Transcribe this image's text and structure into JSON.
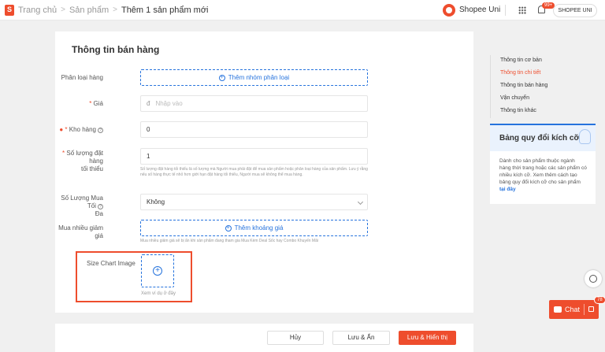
{
  "topbar": {
    "breadcrumb": [
      "Trang chủ",
      "Sản phẩm",
      "Thêm 1 sản phẩm mới"
    ],
    "shop_name": "Shopee Uni",
    "notification_badge": "99+",
    "user_label": "SHOPEE UNI"
  },
  "form": {
    "section_title": "Thông tin bán hàng",
    "variation": {
      "label": "Phân loại hàng",
      "button": "Thêm nhóm phân loại"
    },
    "price": {
      "label": "Giá",
      "currency": "đ",
      "placeholder": "Nhập vào"
    },
    "stock": {
      "label": "Kho hàng",
      "value": "0"
    },
    "min_qty": {
      "label_line1": "Số lượng đặt hàng",
      "label_line2": "tối thiểu",
      "value": "1",
      "help": "Số lượng đặt hàng tối thiểu là số lượng mà Người mua phải đặt để mua sản phẩm hoặc phân loại hàng của sản phẩm. Lưu ý rằng nếu số hàng thực tế nhỏ hơn giới hạn đặt hàng tối thiểu, Người mua sẽ không thể mua hàng."
    },
    "max_qty": {
      "label_line1": "Số Lượng Mua Tối",
      "label_line2": "Đa",
      "value": "Không"
    },
    "wholesale": {
      "label": "Mua nhiều giảm giá",
      "button": "Thêm khoảng giá",
      "help": "Mua nhiều giảm giá sẽ bị ẩn khi sản phẩm đang tham gia Mua Kèm Deal Sốc hay Combo Khuyến Mãi"
    },
    "size_chart": {
      "label": "Size Chart Image",
      "example_link": "Xem ví dụ ở đây"
    }
  },
  "footer": {
    "cancel": "Hủy",
    "save_hide": "Lưu & Ẩn",
    "save_show": "Lưu & Hiển thị"
  },
  "sidenav": {
    "items": [
      "Thông tin cơ bản",
      "Thông tin chi tiết",
      "Thông tin bán hàng",
      "Vận chuyển",
      "Thông tin khác"
    ]
  },
  "size_card": {
    "title": "Bảng quy đổi kích cỡ",
    "body": "Dành cho sản phẩm thuộc ngành hàng thời trang hoặc các sản phẩm có nhiều kích cỡ. Xem thêm cách tạo bảng quy đổi kích cỡ cho sản phẩm ",
    "link": "tại đây"
  },
  "chat": {
    "label": "Chat",
    "badge": "78"
  },
  "colors": {
    "brand": "#ee4d2d",
    "link": "#2673dd"
  }
}
